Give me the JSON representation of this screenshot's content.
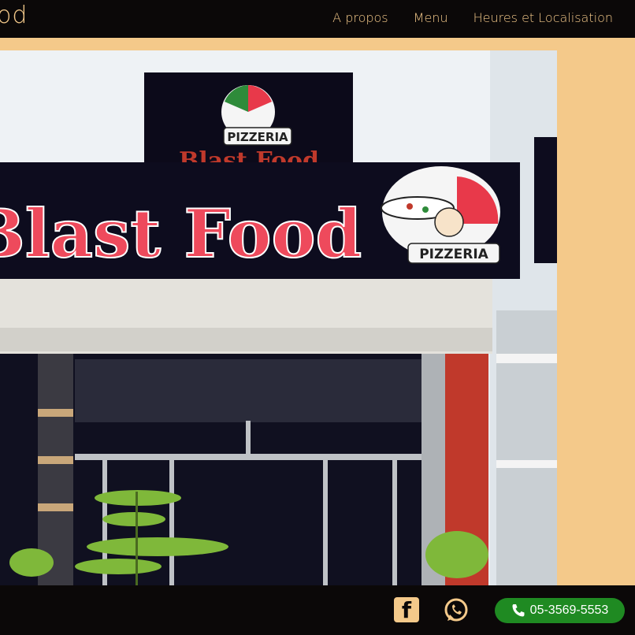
{
  "header": {
    "brand": "od",
    "nav": [
      "A propos",
      "Menu",
      "Heures et Localisation"
    ]
  },
  "hero": {
    "sign_main": "Blast Food",
    "sign_small": "PIZZERIA",
    "sign_upper": "Blast Food"
  },
  "footer": {
    "phone": "05-3569-5553",
    "facebook_icon": "facebook-icon",
    "whatsapp_icon": "whatsapp-icon",
    "phone_icon": "phone-icon"
  },
  "colors": {
    "accent": "#f4c98a",
    "dark": "#0b0808",
    "phone_green": "#1f8a22",
    "sign_red": "#e8394a"
  }
}
